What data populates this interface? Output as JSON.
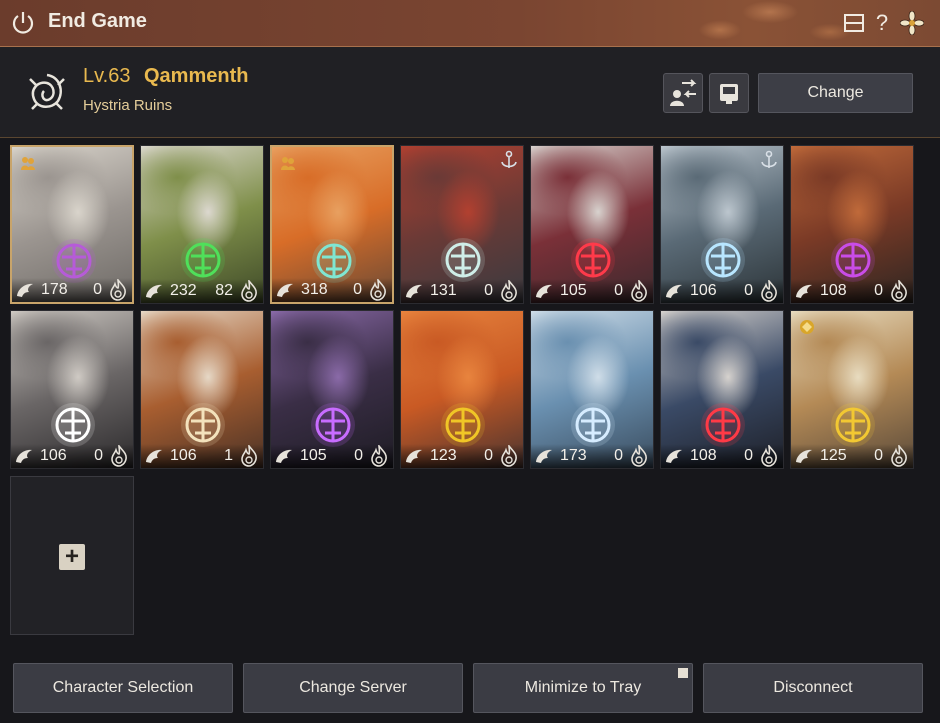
{
  "window": {
    "title": "End Game"
  },
  "header": {
    "level_prefix": "Lv.",
    "level": "63",
    "name": "Qammenth",
    "location": "Hystria Ruins",
    "change_label": "Change"
  },
  "characters": [
    {
      "v1": "178",
      "v2": "0",
      "emblem_color": "#b65bd8",
      "bg": [
        "#d9d4cb",
        "#9b9590",
        "#6e6a66"
      ],
      "selected": true,
      "badge": "party"
    },
    {
      "v1": "232",
      "v2": "82",
      "emblem_color": "#4fe05a",
      "bg": [
        "#dcd8cf",
        "#7f8f4a",
        "#3f4a28"
      ],
      "selected": false,
      "badge": ""
    },
    {
      "v1": "318",
      "v2": "0",
      "emblem_color": "#7fe6d2",
      "bg": [
        "#e8a060",
        "#d86d28",
        "#6a4a36"
      ],
      "selected": true,
      "badge": "party"
    },
    {
      "v1": "131",
      "v2": "0",
      "emblem_color": "#cfeee8",
      "bg": [
        "#b24030",
        "#6a3a36",
        "#3a3a40"
      ],
      "selected": false,
      "badge": "anchor"
    },
    {
      "v1": "105",
      "v2": "0",
      "emblem_color": "#ff3a4a",
      "bg": [
        "#d8d2ce",
        "#7a3038",
        "#3c2a2e"
      ],
      "selected": false,
      "badge": ""
    },
    {
      "v1": "106",
      "v2": "0",
      "emblem_color": "#b8e6ff",
      "bg": [
        "#bcc6ce",
        "#5a6a76",
        "#2c3438"
      ],
      "selected": false,
      "badge": "anchor"
    },
    {
      "v1": "108",
      "v2": "0",
      "emblem_color": "#c94ce8",
      "bg": [
        "#c06a3a",
        "#7a3a26",
        "#2e2622"
      ],
      "selected": false,
      "badge": ""
    },
    {
      "v1": "106",
      "v2": "0",
      "emblem_color": "#ffffff",
      "bg": [
        "#cfcac4",
        "#6a6666",
        "#2c2a2c"
      ],
      "selected": false,
      "badge": ""
    },
    {
      "v1": "106",
      "v2": "1",
      "emblem_color": "#f3e2bc",
      "bg": [
        "#e6d8c6",
        "#a85e30",
        "#4a3226"
      ],
      "selected": false,
      "badge": ""
    },
    {
      "v1": "105",
      "v2": "0",
      "emblem_color": "#c86cff",
      "bg": [
        "#8a6aa8",
        "#3a2e46",
        "#1e1c24"
      ],
      "selected": false,
      "badge": ""
    },
    {
      "v1": "123",
      "v2": "0",
      "emblem_color": "#f0c626",
      "bg": [
        "#e8843e",
        "#c95a24",
        "#4a3430"
      ],
      "selected": false,
      "badge": ""
    },
    {
      "v1": "173",
      "v2": "0",
      "emblem_color": "#d6ecff",
      "bg": [
        "#cfdde8",
        "#6a90b0",
        "#3a4c5e"
      ],
      "selected": false,
      "badge": ""
    },
    {
      "v1": "108",
      "v2": "0",
      "emblem_color": "#ff3a46",
      "bg": [
        "#d6d2ce",
        "#3a4a66",
        "#1e2028"
      ],
      "selected": false,
      "badge": ""
    },
    {
      "v1": "125",
      "v2": "0",
      "emblem_color": "#f2c832",
      "bg": [
        "#e8dcc0",
        "#b48a56",
        "#5a4a3a"
      ],
      "selected": false,
      "badge": "coin"
    }
  ],
  "footer": {
    "character_selection": "Character Selection",
    "change_server": "Change Server",
    "minimize_to_tray": "Minimize to Tray",
    "disconnect": "Disconnect"
  },
  "colors": {
    "accent": "#e9b94f",
    "titlebar": "#7a4531"
  }
}
